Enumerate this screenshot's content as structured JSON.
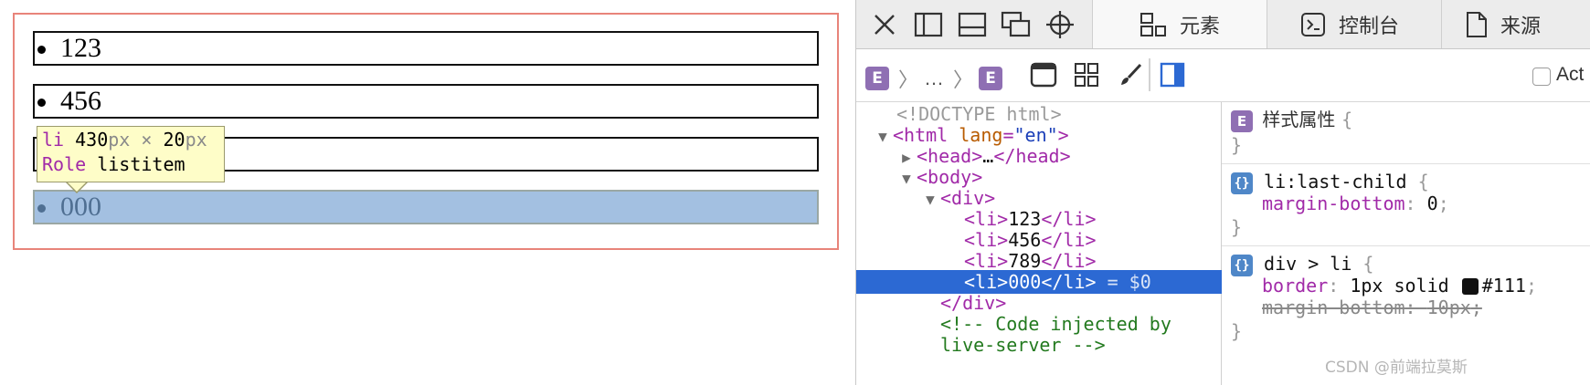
{
  "preview": {
    "list_items": [
      "123",
      "456",
      "789",
      "000"
    ],
    "tooltip": {
      "tag": "li",
      "width": "430",
      "px1": "px",
      "times": "×",
      "height": "20",
      "px2": "px",
      "role_label": "Role",
      "role_value": "listitem"
    }
  },
  "devtools": {
    "tabs": [
      {
        "label": "元素",
        "icon": "elements-icon",
        "active": true
      },
      {
        "label": "控制台",
        "icon": "console-icon",
        "active": false
      },
      {
        "label": "来源",
        "icon": "sources-icon",
        "active": false
      }
    ],
    "breadcrumb": {
      "ellipsis": "…",
      "badge": "E"
    },
    "dom_lines": [
      {
        "indent": 1,
        "tri": "",
        "html": "doctype",
        "text": "<!DOCTYPE html>"
      },
      {
        "indent": 0,
        "tri": "▼",
        "text": "html",
        "attr": "lang",
        "value": "\"en\""
      },
      {
        "indent": 1,
        "tri": "▶",
        "text": "head"
      },
      {
        "indent": 1,
        "tri": "▼",
        "text": "body"
      },
      {
        "indent": 2,
        "tri": "▼",
        "text": "div"
      },
      {
        "indent": 3,
        "text": "li",
        "content": "123"
      },
      {
        "indent": 3,
        "text": "li",
        "content": "456"
      },
      {
        "indent": 3,
        "text": "li",
        "content": "789"
      },
      {
        "indent": 3,
        "text": "li",
        "content": "000",
        "selected": true,
        "suffix": "= $0"
      },
      {
        "indent": 2,
        "text": "/div"
      },
      {
        "indent": 2,
        "comment": "<!-- Code injected by"
      },
      {
        "indent": 2,
        "comment": "live-server -->"
      }
    ],
    "styles": {
      "filter_label": "Act",
      "style_attr_label": "样式属性",
      "rule1": {
        "selector": "li:last-child",
        "prop": "margin-bottom",
        "value": "0"
      },
      "rule2": {
        "selector": "div > li",
        "prop1": "border",
        "value1a": "1px solid",
        "color_hex": "#111",
        "prop2": "margin-bottom",
        "value2": "10px"
      }
    }
  },
  "watermark": "CSDN @前端拉莫斯",
  "colors": {
    "highlight": "#a3c0e1",
    "selected_row": "#2c69d3",
    "container_border": "#e8847a",
    "tooltip_bg": "#fefdc8"
  }
}
